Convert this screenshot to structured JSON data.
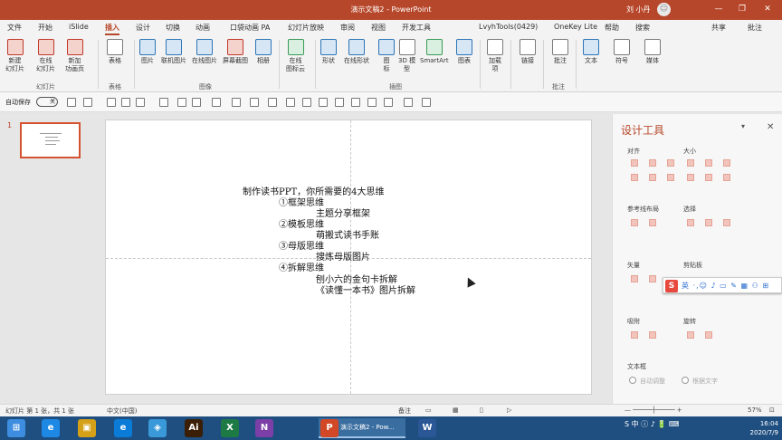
{
  "window": {
    "title": "演示文稿2 - PowerPoint",
    "user": "刘 小丹",
    "avatar_glyph": "☺",
    "minimize": "—",
    "restore": "❐",
    "close": "✕"
  },
  "tabs": [
    "文件",
    "开始",
    "iSlide",
    "插入",
    "设计",
    "切换",
    "动画",
    "口袋动画 PA",
    "幻灯片放映",
    "审阅",
    "视图",
    "开发工具",
    "LvyhTools(0429)",
    "OneKey Lite",
    "帮助",
    "搜索"
  ],
  "tabs_active_index": 3,
  "share_label": "共享",
  "comment_label": "批注",
  "ribbon": {
    "buttons": [
      {
        "label": "新建\n幻灯片",
        "group": "slides"
      },
      {
        "label": "在线\n幻灯片",
        "group": "slides"
      },
      {
        "label": "新加\n功画页",
        "group": "slides"
      },
      {
        "label": "表格",
        "group": "table"
      },
      {
        "label": "图片",
        "group": "images"
      },
      {
        "label": "联机图片",
        "group": "images"
      },
      {
        "label": "在线图片",
        "group": "images"
      },
      {
        "label": "屏幕截图",
        "group": "images"
      },
      {
        "label": "相册",
        "group": "images"
      },
      {
        "label": "在线\n图标云",
        "group": "islide"
      },
      {
        "label": "形状",
        "group": "illustrations"
      },
      {
        "label": "在线形状",
        "group": "illustrations"
      },
      {
        "label": "图\n标",
        "group": "illustrations"
      },
      {
        "label": "3D 模\n型",
        "group": "illustrations"
      },
      {
        "label": "SmartArt",
        "group": "illustrations"
      },
      {
        "label": "图表",
        "group": "illustrations"
      },
      {
        "label": "加载\n项",
        "group": "addins"
      },
      {
        "label": "链接",
        "group": "links"
      },
      {
        "label": "批注",
        "group": "comments"
      },
      {
        "label": "文本",
        "group": "text"
      },
      {
        "label": "符号",
        "group": "symbols"
      },
      {
        "label": "媒体",
        "group": "media"
      }
    ],
    "group_labels": [
      "幻灯片",
      "表格",
      "图像",
      "插图",
      "批注"
    ]
  },
  "qat": {
    "autosave_label": "自动保存",
    "autosave_state": "关"
  },
  "slide_panel": {
    "slide_number": "1"
  },
  "slide": {
    "title_line": "制作读书PPT，你所需要的4大思维",
    "lines": [
      "①框架思维",
      "主题分享框架",
      "②模板思维",
      "萌搬式读书手账",
      "③母版思维",
      "搜炼母版图片",
      "④拆解思维",
      "刨小六的金句卡拆解",
      "《读懂一本书》图片拆解"
    ]
  },
  "design_pane": {
    "title": "设计工具",
    "sections": [
      "对齐",
      "大小",
      "参考线布局",
      "选择",
      "矢量",
      "剪贴板",
      "吸附",
      "旋转",
      "文本框"
    ],
    "radio_labels": [
      "自动调整",
      "根据文字"
    ]
  },
  "ime": {
    "logo": "S",
    "text": "英 ·,☺ ♪ ▭ ✎ ▦ ⚇ ⊞"
  },
  "statusbar": {
    "slide_info": "幻灯片 第 1 张，共 1 张",
    "language": "中文(中国)",
    "notes": "备注",
    "zoom": "57%"
  },
  "taskbar": {
    "active_window_label": "演示文稿2 - Pow...",
    "tray_text": "S 中 ⓘ ♪ 🔋 ⌨",
    "time": "16:04",
    "date": "2020/7/9",
    "app_icons": [
      {
        "name": "start",
        "glyph": "⊞",
        "color": "#3d8ee0"
      },
      {
        "name": "ie",
        "glyph": "e",
        "color": "#1e88e5"
      },
      {
        "name": "explorer",
        "glyph": "▣",
        "color": "#d4a017"
      },
      {
        "name": "edge",
        "glyph": "e",
        "color": "#0a7bd6"
      },
      {
        "name": "network",
        "glyph": "◈",
        "color": "#3a9ad9"
      },
      {
        "name": "illustrator",
        "glyph": "Ai",
        "color": "#3a1e05"
      },
      {
        "name": "excel",
        "glyph": "X",
        "color": "#1d7a44"
      },
      {
        "name": "onenote",
        "glyph": "N",
        "color": "#7b3fa7"
      },
      {
        "name": "powerpoint",
        "glyph": "P",
        "color": "#d24726"
      },
      {
        "name": "word",
        "glyph": "W",
        "color": "#2b5797"
      }
    ]
  }
}
